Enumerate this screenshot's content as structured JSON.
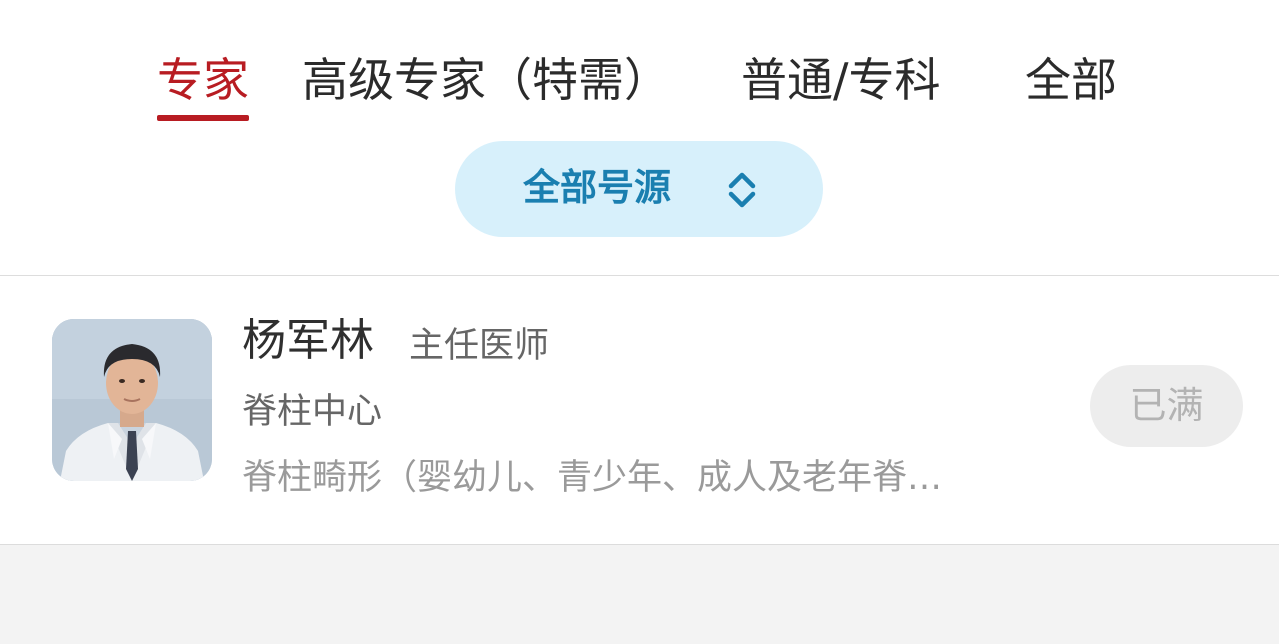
{
  "tabs": [
    {
      "label": "专家",
      "active": true
    },
    {
      "label": "高级专家（特需）",
      "active": false
    },
    {
      "label": "普通/专科",
      "active": false
    },
    {
      "label": "全部",
      "active": false
    }
  ],
  "filter": {
    "label": "全部号源",
    "icon": "up-down-chevron-icon"
  },
  "doctor": {
    "name": "杨军林",
    "title": "主任医师",
    "department": "脊柱中心",
    "specialty": "脊柱畸形（婴幼儿、青少年、成人及老年脊…",
    "status": "已满"
  },
  "colors": {
    "active_tab": "#b81c22",
    "filter_bg": "#d7f0fb",
    "filter_text": "#1a7fb0",
    "page_bg": "#f3f3f3"
  }
}
